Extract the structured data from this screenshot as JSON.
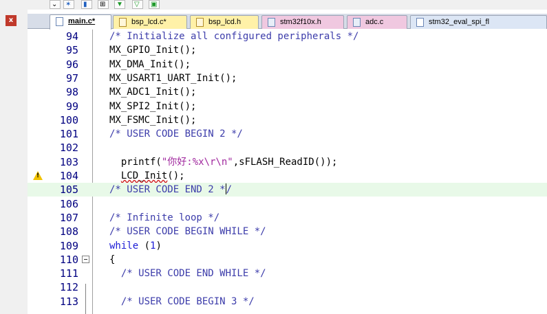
{
  "toolbar": {
    "buttons": [
      {
        "icon": "dropdown-chevron-icon"
      },
      {
        "icon": "wand-icon"
      },
      {
        "icon": "bookmark-icon"
      },
      {
        "icon": "layout-icon"
      },
      {
        "icon": "arrow-down-green-icon"
      },
      {
        "icon": "funnel-icon"
      },
      {
        "icon": "image-icon"
      }
    ]
  },
  "left_panel": {
    "close_label": "x"
  },
  "tabs": [
    {
      "label": "main.c*",
      "active": true,
      "style": "active"
    },
    {
      "label": "bsp_lcd.c*",
      "active": false,
      "style": "t-yellow"
    },
    {
      "label": "bsp_lcd.h",
      "active": false,
      "style": "t-yellow"
    },
    {
      "label": "stm32f10x.h",
      "active": false,
      "style": "t-pink"
    },
    {
      "label": "adc.c",
      "active": false,
      "style": "t-pink"
    },
    {
      "label": "stm32_eval_spi_fl",
      "active": false,
      "style": "t-blue"
    }
  ],
  "editor": {
    "lines": [
      {
        "num": "94",
        "segments": [
          [
            "cmt",
            "/* Initialize all configured peripherals */"
          ]
        ],
        "indent": 0
      },
      {
        "num": "95",
        "segments": [
          [
            "",
            "MX_GPIO_Init();"
          ]
        ],
        "indent": 0
      },
      {
        "num": "96",
        "segments": [
          [
            "",
            "MX_DMA_Init();"
          ]
        ],
        "indent": 0
      },
      {
        "num": "97",
        "segments": [
          [
            "",
            "MX_USART1_UART_Init();"
          ]
        ],
        "indent": 0
      },
      {
        "num": "98",
        "segments": [
          [
            "",
            "MX_ADC1_Init();"
          ]
        ],
        "indent": 0
      },
      {
        "num": "99",
        "segments": [
          [
            "",
            "MX_SPI2_Init();"
          ]
        ],
        "indent": 0
      },
      {
        "num": "100",
        "segments": [
          [
            "",
            "MX_FSMC_Init();"
          ]
        ],
        "indent": 0
      },
      {
        "num": "101",
        "segments": [
          [
            "cmt",
            "/* USER CODE BEGIN 2 */"
          ]
        ],
        "indent": 0
      },
      {
        "num": "102",
        "segments": [],
        "indent": 0
      },
      {
        "num": "103",
        "segments": [
          [
            "",
            "  printf("
          ],
          [
            "str",
            "\"你好:%x\\r\\n\""
          ],
          [
            "",
            ",sFLASH_ReadID());"
          ]
        ],
        "indent": 0
      },
      {
        "num": "104",
        "segments": [
          [
            "",
            "  "
          ],
          [
            "squig",
            "LCD_Init"
          ],
          [
            "",
            "();"
          ]
        ],
        "indent": 0,
        "warning": true
      },
      {
        "num": "105",
        "segments": [
          [
            "cmt",
            "/* USER CODE END 2 *"
          ],
          [
            "caret",
            ""
          ],
          [
            "cmt",
            "/"
          ]
        ],
        "indent": 0,
        "current": true
      },
      {
        "num": "106",
        "segments": [],
        "indent": 0
      },
      {
        "num": "107",
        "segments": [
          [
            "cmt",
            "/* Infinite loop */"
          ]
        ],
        "indent": 0
      },
      {
        "num": "108",
        "segments": [
          [
            "cmt",
            "/* USER CODE BEGIN WHILE */"
          ]
        ],
        "indent": 0
      },
      {
        "num": "109",
        "segments": [
          [
            "kw",
            "while"
          ],
          [
            "",
            " ("
          ],
          [
            "num",
            "1"
          ],
          [
            "",
            ")"
          ]
        ],
        "indent": 0
      },
      {
        "num": "110",
        "segments": [
          [
            "",
            "{"
          ]
        ],
        "indent": 0,
        "fold": true
      },
      {
        "num": "111",
        "segments": [
          [
            "cmt",
            "  /* USER CODE END WHILE */"
          ]
        ],
        "indent": 0
      },
      {
        "num": "112",
        "segments": [],
        "indent": 0
      },
      {
        "num": "113",
        "segments": [
          [
            "cmt",
            "  /* USER CODE BEGIN 3 */"
          ]
        ],
        "indent": 0
      }
    ]
  }
}
